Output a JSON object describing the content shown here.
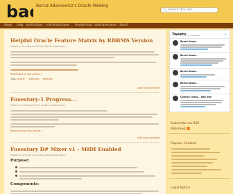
{
  "header": {
    "logo_text": "bao",
    "site_title": "Bernd Adamowicz's Oracle Weblog",
    "search_placeholder": "Search this site..."
  },
  "nav": [
    "blogs",
    "blog",
    "grails/apps",
    "oracle/app/apex",
    "devops/app",
    "ajax/apex/apps",
    "about"
  ],
  "posts": [
    {
      "title": "Helpful Oracle Feature Matrix by RDBMS Version",
      "meta": "Posted on 2nd March 2013 by Bernd Adamowicz",
      "paragraphs": [
        "I opened an SR recently while I was trying to get a feature to work in my ... was probably the version of my instance ... a listing of Oracle features and their versions for each release in ...",
        "You must select the sent email available from Oracle has trying to say ... it is not possible. Old 10.1 trying to build the bit on the Oracle Support Note"
      ],
      "link_line": "Open Support - Functional Licensing by Edition",
      "read_more": "Read More in this article »",
      "tags_label": "Tags:",
      "tags": [
        "oracle",
        "licensing",
        "features"
      ],
      "comments": "Add new comment"
    },
    {
      "title": "Fusestory-1 Progress...",
      "meta": "Posted on 27th April 2013 by Bernd Adamowicz",
      "paragraphs": [
        "Have been making decent progress on the Fusestory-1 MIDI controller.",
        "I decided to take a more engineered design with on a Teensy++ 2.0 ... using the ... a shift register set to a 10 pin ... built the box ... a simpler prototype.",
        "I have 4 pots, 4 slider, 4 momentary button, and many other ... I will post some video of the ... more progress is made."
      ],
      "read_more": "Read more of this article »",
      "comments": "Add new comment"
    },
    {
      "title": "Fusestory D# Mixer v1 - MIDI Enabled",
      "meta": "Posted on 2nd March 2013 by Bernd Adamowicz",
      "sections": [
        {
          "heading": "Purpose:",
          "bullets": [
            "Build a MIDI enabled mixer controller ... stereo track in various audio applications.",
            "Provide a per-track mute and solo control ... Control system.",
            "The software requires a full decked Ableton ... parameter panel controls for controlling the ... mixer."
          ]
        },
        {
          "heading": "Components:",
          "bullets": [
            "1 Arduino UNO ... 16 control to ... channel ... Board(s) ... I 1 N ... 3 of 10 ..."
          ]
        }
      ]
    }
  ],
  "twitter": {
    "header": "Tweets",
    "by": "by @baoweb",
    "tweets": [
      {
        "name": "Bernd Adam..."
      },
      {
        "name": "Bernd Adam..."
      },
      {
        "name": "Bernd Adam..."
      },
      {
        "name": "Bernd Adam..."
      },
      {
        "name": "Carolyn Cassa... Bao Dan"
      }
    ]
  },
  "sidebar": {
    "subscribe_label": "Subscribe via RSS",
    "subscribe_sub": "RSS Feed",
    "popular_title": "Popular Content",
    "legal_title": "Legal Notice"
  },
  "colors": {
    "header_bg": "#f3ca4f",
    "nav_bg": "#7a3c08",
    "page_bg": "#fde7a4",
    "content_bg": "#fdf6e3",
    "title_color": "#b8641e"
  }
}
